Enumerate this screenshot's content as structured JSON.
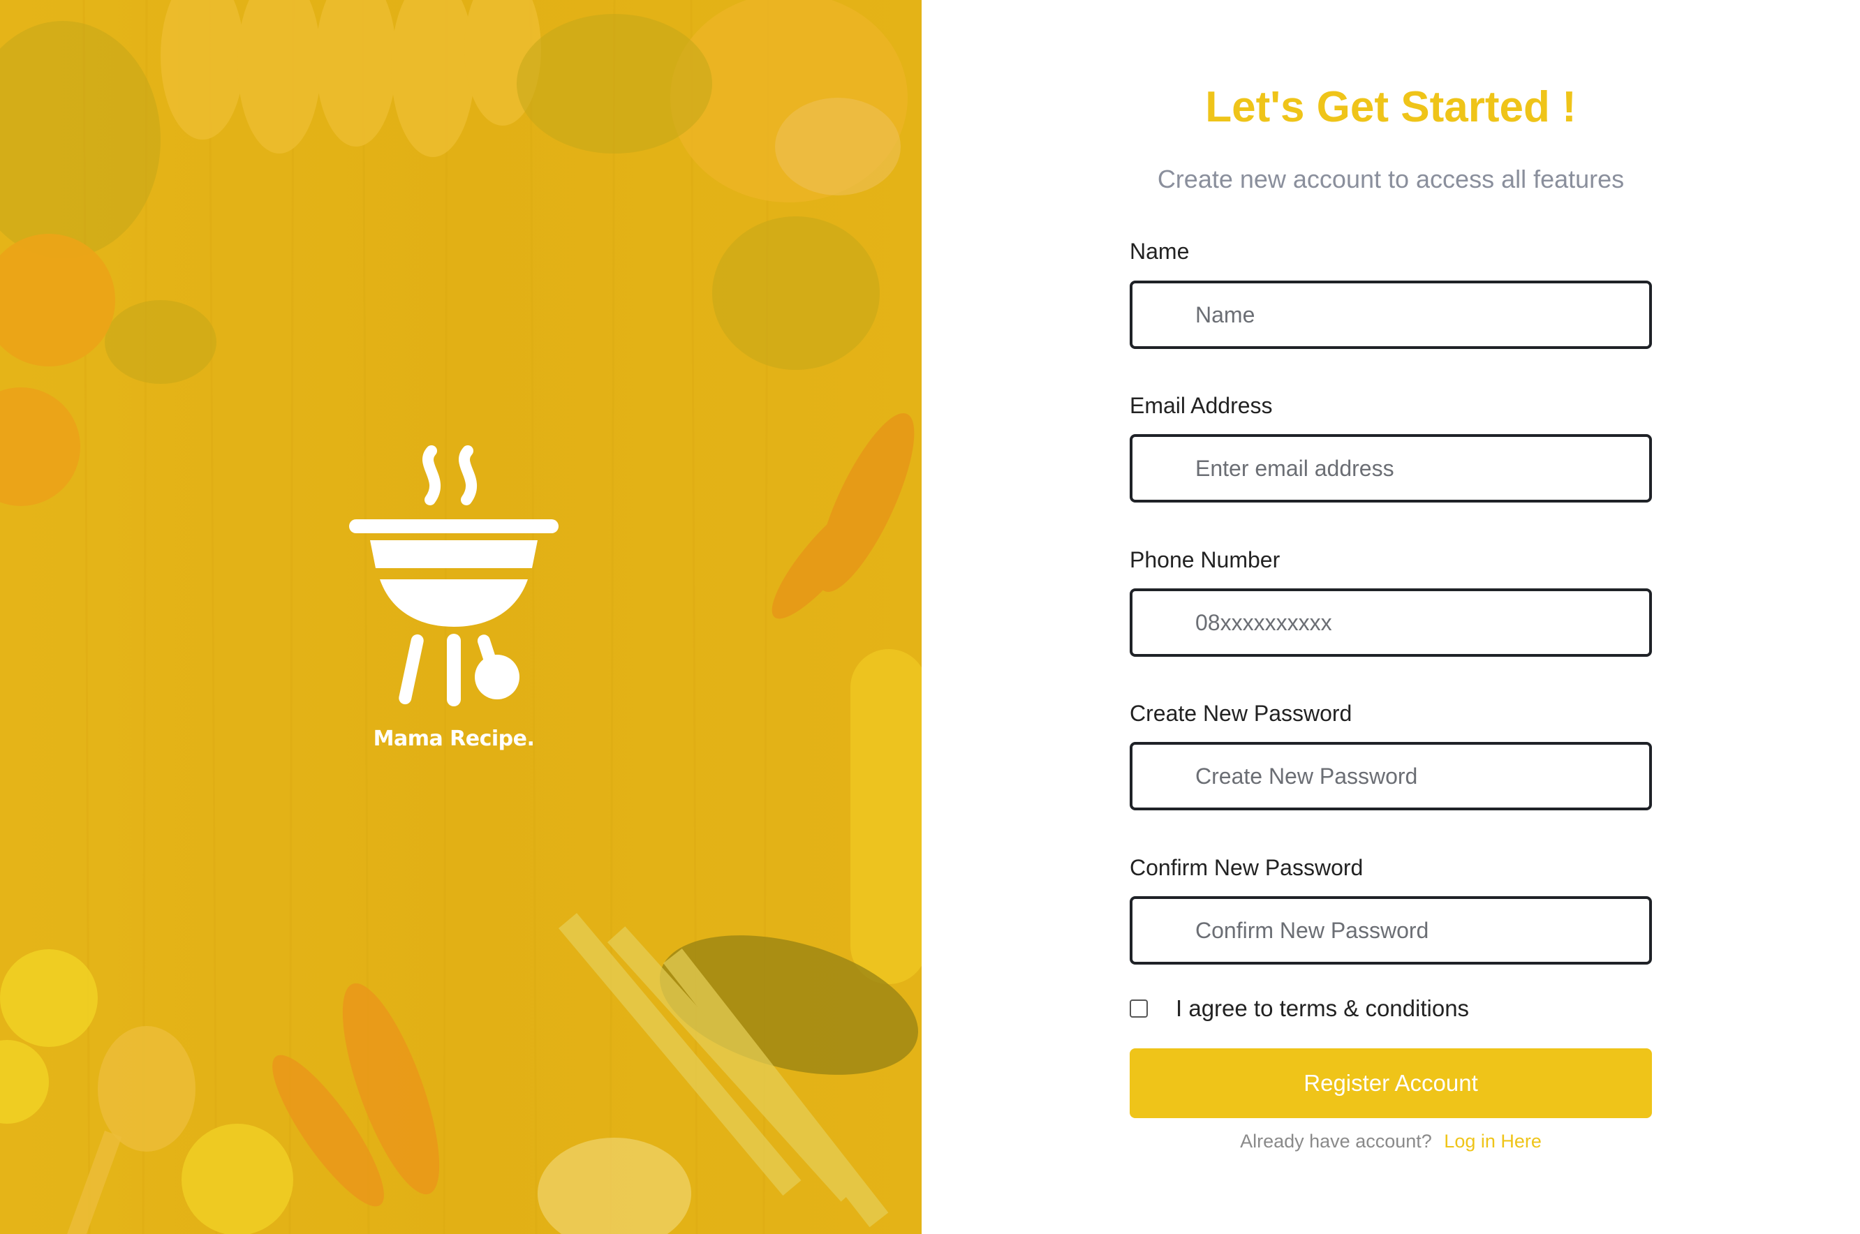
{
  "brand": {
    "name": "Mama Recipe.",
    "logo_icon": "grill-icon"
  },
  "form": {
    "title": "Let's Get Started !",
    "subtitle": "Create new account to access all features",
    "fields": {
      "name": {
        "label": "Name",
        "placeholder": "Name",
        "value": ""
      },
      "email": {
        "label": "Email Address",
        "placeholder": "Enter email address",
        "value": ""
      },
      "phone": {
        "label": "Phone Number",
        "placeholder": "08xxxxxxxxxx",
        "value": ""
      },
      "password": {
        "label": "Create New Password",
        "placeholder": "Create New Password",
        "value": ""
      },
      "confirm": {
        "label": "Confirm New Password",
        "placeholder": "Confirm New Password",
        "value": ""
      }
    },
    "agree": {
      "label": "I agree to terms & conditions",
      "checked": false
    },
    "submit_label": "Register Account",
    "login_prompt": "Already have account?",
    "login_link": "Log in Here"
  },
  "colors": {
    "accent": "#efc419",
    "hero_overlay": "#e3b216",
    "subtitle": "#8a8f9c",
    "input_border": "#1f2227"
  }
}
